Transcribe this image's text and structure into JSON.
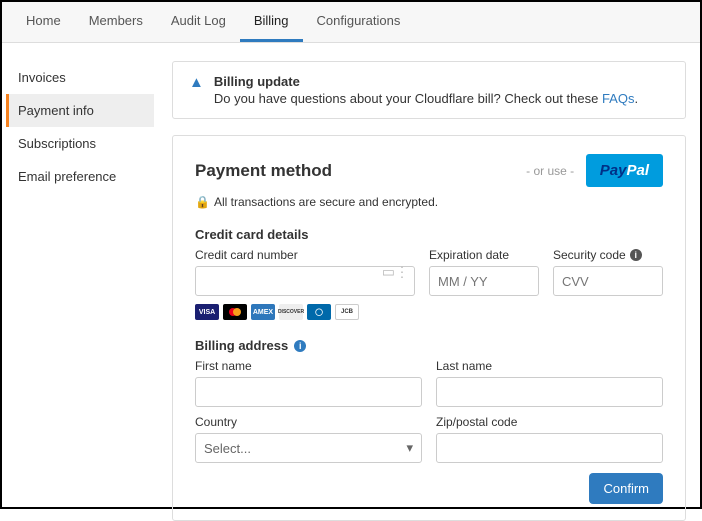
{
  "topnav": {
    "items": [
      {
        "label": "Home"
      },
      {
        "label": "Members"
      },
      {
        "label": "Audit Log"
      },
      {
        "label": "Billing"
      },
      {
        "label": "Configurations"
      }
    ]
  },
  "sidebar": {
    "items": [
      {
        "label": "Invoices"
      },
      {
        "label": "Payment info"
      },
      {
        "label": "Subscriptions"
      },
      {
        "label": "Email preference"
      }
    ]
  },
  "notice": {
    "title": "Billing update",
    "text": "Do you have questions about your Cloudflare bill? Check out these ",
    "link": "FAQs",
    "suffix": "."
  },
  "payment": {
    "heading": "Payment method",
    "or_use": "- or use -",
    "paypal_p1": "Pay",
    "paypal_p2": "Pal",
    "secure": "All transactions are secure and encrypted.",
    "cc_section": "Credit card details",
    "cc_number_label": "Credit card number",
    "cc_number_value": "",
    "exp_label": "Expiration date",
    "exp_placeholder": "MM / YY",
    "exp_value": "",
    "cvv_label": "Security code",
    "cvv_placeholder": "CVV",
    "cvv_value": "",
    "billing_section": "Billing address",
    "first_name_label": "First name",
    "first_name_value": "",
    "last_name_label": "Last name",
    "last_name_value": "",
    "country_label": "Country",
    "country_value": "Select...",
    "zip_label": "Zip/postal code",
    "zip_value": "",
    "confirm": "Confirm"
  },
  "brands": {
    "visa": "VISA",
    "amex": "AMEX",
    "disc": "DISCOVER",
    "diners": "◯",
    "jcb": "JCB"
  }
}
